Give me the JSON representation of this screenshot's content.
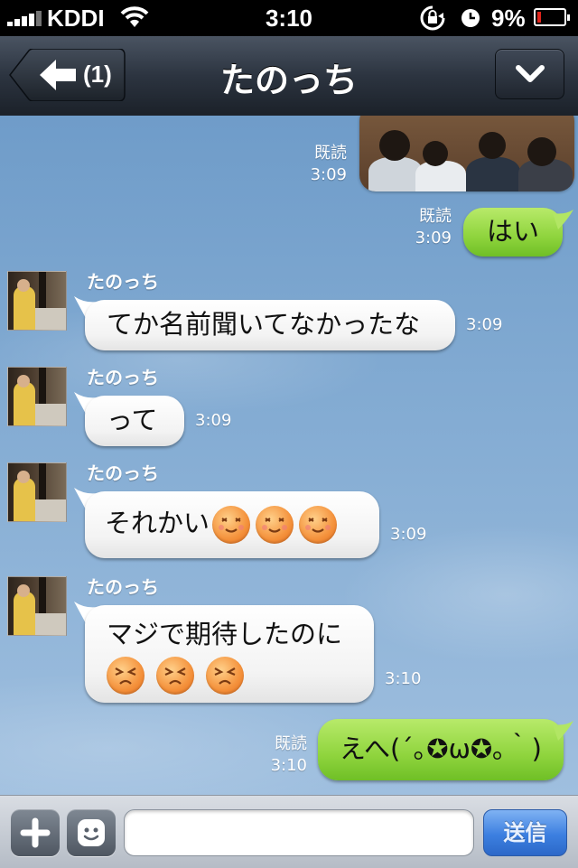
{
  "status_bar": {
    "carrier": "KDDI",
    "time": "3:10",
    "battery_percent": "9%",
    "battery_level": 0.09,
    "battery_color": "#e0241b"
  },
  "nav": {
    "back_icon": "left-arrow-icon",
    "back_badge": "(1)",
    "title": "たのっち",
    "menu_icon": "chevron-down-icon"
  },
  "messages": {
    "m0": {
      "side": "outgoing",
      "type": "photo",
      "read": "既読",
      "time": "3:09"
    },
    "m1": {
      "side": "outgoing",
      "read": "既読",
      "time": "3:09",
      "text": "はい"
    },
    "m2": {
      "side": "incoming",
      "sender": "たのっち",
      "time": "3:09",
      "text": "てか名前聞いてなかったな"
    },
    "m3": {
      "side": "incoming",
      "sender": "たのっち",
      "time": "3:09",
      "text": "って"
    },
    "m4": {
      "side": "incoming",
      "sender": "たのっち",
      "time": "3:09",
      "text": "それかい",
      "emoji": [
        "smiling-face-icon",
        "smiling-face-icon",
        "smiling-face-icon"
      ]
    },
    "m5": {
      "side": "incoming",
      "sender": "たのっち",
      "time": "3:10",
      "text": "マジで期待したのに",
      "emoji": [
        "frustrated-face-icon",
        "frustrated-face-icon",
        "frustrated-face-icon"
      ]
    },
    "m6": {
      "side": "outgoing",
      "read": "既読",
      "time": "3:10",
      "text": "えへ(´｡✪ω✪｡｀)"
    }
  },
  "input_bar": {
    "plus_icon": "plus-icon",
    "sticker_icon": "sticker-face-icon",
    "message_value": "",
    "send_label": "送信"
  },
  "colors": {
    "outgoing_bubble": "#8fd43d",
    "incoming_bubble": "#ffffff",
    "send_button": "#3c7fe0"
  }
}
